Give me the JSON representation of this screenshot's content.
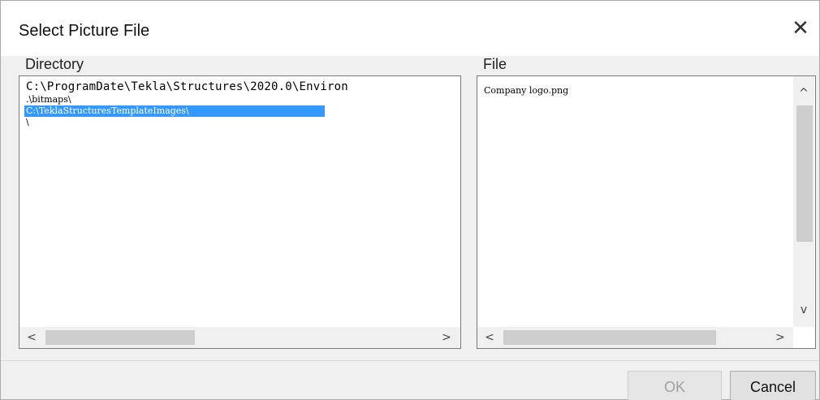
{
  "dialog": {
    "title": "Select Picture File",
    "close_glyph": "✕"
  },
  "directory": {
    "label": "Directory",
    "items": [
      "C:\\ProgramDate\\Tekla\\Structures\\2020.0\\Environ",
      ".\\bitmaps\\",
      "C:\\TeklaStructuresTemplateImages\\",
      "\\"
    ],
    "selected_index": 2
  },
  "file": {
    "label": "File",
    "items": [
      "Company logo.png"
    ]
  },
  "scroll_glyphs": {
    "left": "<",
    "right": ">",
    "up": "^",
    "down": "v"
  },
  "buttons": {
    "ok_label": "OK",
    "cancel_label": "Cancel"
  },
  "colors": {
    "selection": "#3399ff",
    "dialog_bg": "#f0f0f0"
  }
}
